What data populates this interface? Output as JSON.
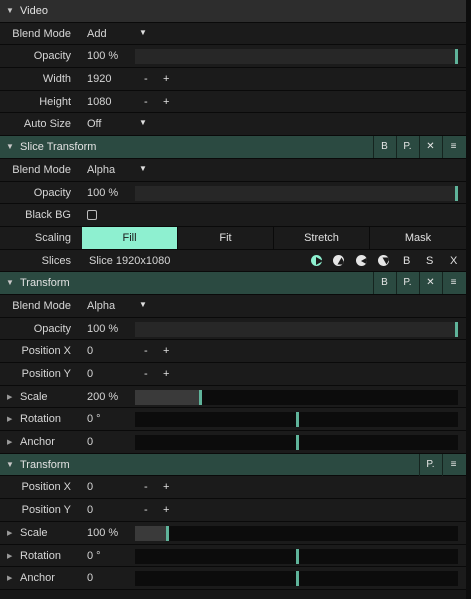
{
  "video": {
    "title": "Video",
    "blend_mode": {
      "label": "Blend Mode",
      "value": "Add"
    },
    "opacity": {
      "label": "Opacity",
      "value": "100 %",
      "level": 1.0
    },
    "width": {
      "label": "Width",
      "value": "1920"
    },
    "height": {
      "label": "Height",
      "value": "1080"
    },
    "auto_size": {
      "label": "Auto Size",
      "value": "Off"
    }
  },
  "slice_transform": {
    "title": "Slice Transform",
    "buttons": [
      "B",
      "P.",
      "✕",
      "≡"
    ],
    "blend_mode": {
      "label": "Blend Mode",
      "value": "Alpha"
    },
    "opacity": {
      "label": "Opacity",
      "value": "100 %",
      "level": 1.0
    },
    "black_bg": {
      "label": "Black BG",
      "checked": false
    },
    "scaling": {
      "label": "Scaling",
      "options": [
        "Fill",
        "Fit",
        "Stretch",
        "Mask"
      ],
      "selected": "Fill"
    },
    "slices": {
      "label": "Slices",
      "value": "Slice 1920x1080",
      "letters": [
        "B",
        "S",
        "X"
      ]
    }
  },
  "transform1": {
    "title": "Transform",
    "buttons": [
      "B",
      "P.",
      "✕",
      "≡"
    ],
    "blend_mode": {
      "label": "Blend Mode",
      "value": "Alpha"
    },
    "opacity": {
      "label": "Opacity",
      "value": "100 %",
      "level": 1.0
    },
    "position_x": {
      "label": "Position X",
      "value": "0"
    },
    "position_y": {
      "label": "Position Y",
      "value": "0"
    },
    "scale": {
      "label": "Scale",
      "value": "200 %",
      "level": 0.2
    },
    "rotation": {
      "label": "Rotation",
      "value": "0 °",
      "level": 0.5
    },
    "anchor": {
      "label": "Anchor",
      "value": "0",
      "level": 0.5
    }
  },
  "transform2": {
    "title": "Transform",
    "buttons": [
      "P.",
      "≡"
    ],
    "position_x": {
      "label": "Position X",
      "value": "0"
    },
    "position_y": {
      "label": "Position Y",
      "value": "0"
    },
    "scale": {
      "label": "Scale",
      "value": "100 %",
      "level": 0.1
    },
    "rotation": {
      "label": "Rotation",
      "value": "0 °",
      "level": 0.5
    },
    "anchor": {
      "label": "Anchor",
      "value": "0",
      "level": 0.5
    }
  },
  "symbols": {
    "plus": "+",
    "minus": "-",
    "caret": "▼",
    "collapse": "▼",
    "expand": "▶"
  }
}
